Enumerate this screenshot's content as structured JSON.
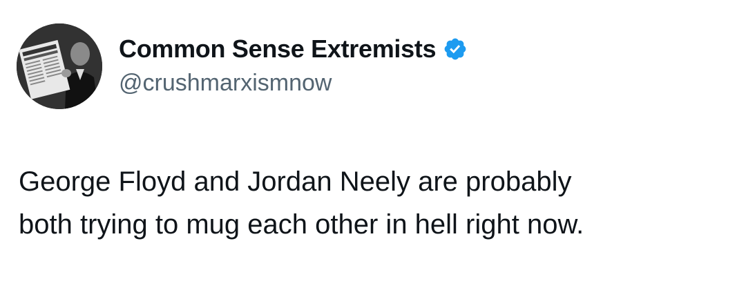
{
  "author": {
    "display_name": "Common Sense Extremists",
    "handle": "@crushmarxismnow",
    "verified": true,
    "avatar_icon": "avatar-photo-man-with-newspaper",
    "verified_icon": "verified-badge-icon",
    "verified_color": "#1d9bf0"
  },
  "tweet": {
    "text_lines": [
      "George Floyd and Jordan Neely are probably",
      "both trying to mug each other in hell right now."
    ]
  }
}
